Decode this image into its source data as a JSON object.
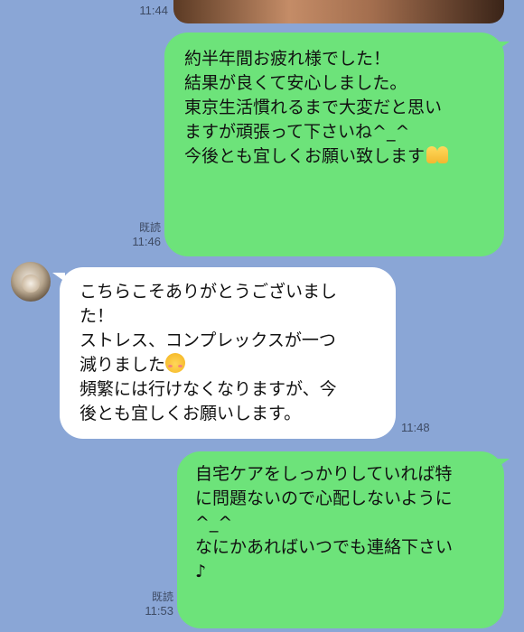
{
  "messages": [
    {
      "id": "m0",
      "direction": "out",
      "type": "photo",
      "time": "11:44"
    },
    {
      "id": "m1",
      "direction": "out",
      "read": "既読",
      "time": "11:46",
      "lines": [
        "約半年間お疲れ様でした！",
        "",
        "結果が良くて安心しました。",
        "",
        "東京生活慣れるまで大変だと思い",
        "ますが頑張って下さいね^_^",
        "",
        "今後とも宜しくお願い致します"
      ],
      "emoji": "palms-up-together"
    },
    {
      "id": "m2",
      "direction": "in",
      "time": "11:48",
      "lines": [
        "こちらこそありがとうございまし",
        "た！",
        "ストレス、コンプレックスが一つ",
        "減りました",
        "頻繁には行けなくなりますが、今",
        "後とも宜しくお願いします。"
      ],
      "emoji": "smiling-face"
    },
    {
      "id": "m3",
      "direction": "out",
      "read": "既読",
      "time": "11:53",
      "lines": [
        "自宅ケアをしっかりしていれば特",
        "に問題ないので心配しないように",
        "^_^",
        "",
        "なにかあればいつでも連絡下さい",
        "♪"
      ]
    }
  ],
  "colors": {
    "background": "#8aa6d6",
    "out_bubble": "#6de37a",
    "in_bubble": "#ffffff"
  }
}
